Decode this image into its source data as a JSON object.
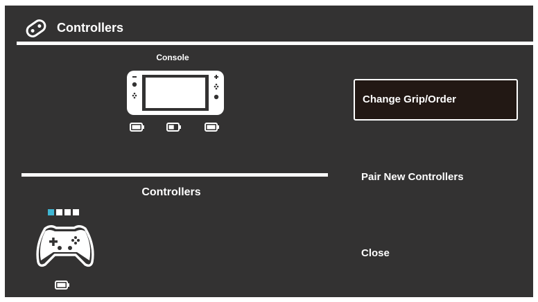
{
  "header": {
    "title": "Controllers",
    "icon": "controller-icon"
  },
  "console": {
    "label": "Console",
    "icon": "switch-console-icon",
    "batteries": [
      {
        "icon": "battery-icon",
        "level": 1.0
      },
      {
        "icon": "battery-icon",
        "level": 0.6
      },
      {
        "icon": "battery-icon",
        "level": 1.0
      }
    ]
  },
  "controllers_section": {
    "title": "Controllers",
    "player_lights": [
      true,
      false,
      false,
      false
    ],
    "controller_icon": "pro-controller-icon",
    "battery": {
      "icon": "battery-icon",
      "level": 1.0
    }
  },
  "menu": {
    "items": [
      {
        "label": "Change Grip/Order",
        "selected": true
      },
      {
        "label": "Pair New Controllers",
        "selected": false
      },
      {
        "label": "Close",
        "selected": false
      }
    ]
  },
  "colors": {
    "background": "#333232",
    "selected_bg": "#221814",
    "accent": "#3fb6d3",
    "foreground": "#ffffff"
  }
}
